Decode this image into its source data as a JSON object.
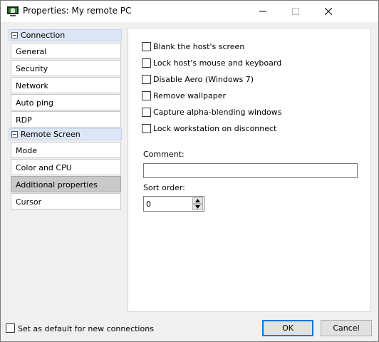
{
  "window": {
    "title": "Properties: My remote PC"
  },
  "sidebar": {
    "sections": [
      {
        "label": "Connection",
        "items": [
          "General",
          "Security",
          "Network",
          "Auto ping",
          "RDP"
        ]
      },
      {
        "label": "Remote Screen",
        "items": [
          "Mode",
          "Color and CPU",
          "Additional properties",
          "Cursor"
        ]
      }
    ],
    "selected_item": "Additional properties"
  },
  "options": [
    {
      "label": "Blank the host's screen",
      "checked": false
    },
    {
      "label": "Lock host's mouse and keyboard",
      "checked": false
    },
    {
      "label": "Disable Aero (Windows 7)",
      "checked": false
    },
    {
      "label": "Remove wallpaper",
      "checked": false
    },
    {
      "label": "Capture alpha-blending windows",
      "checked": false
    },
    {
      "label": "Lock workstation on disconnect",
      "checked": false
    }
  ],
  "comment": {
    "label": "Comment:",
    "value": ""
  },
  "sort_order": {
    "label": "Sort order:",
    "value": "0"
  },
  "footer": {
    "default_label": "Set as default for new connections",
    "default_checked": false,
    "ok_label": "OK",
    "cancel_label": "Cancel"
  },
  "colors": {
    "section_header_bg": "#dde6f4",
    "selected_item_bg": "#c9c9c9",
    "ok_border": "#0078d7",
    "app_icon_green": "#2e8b2e"
  },
  "icons": {
    "app": "remote-desktop-icon",
    "minimize": "minimize-icon",
    "maximize": "maximize-icon",
    "close": "close-icon"
  }
}
